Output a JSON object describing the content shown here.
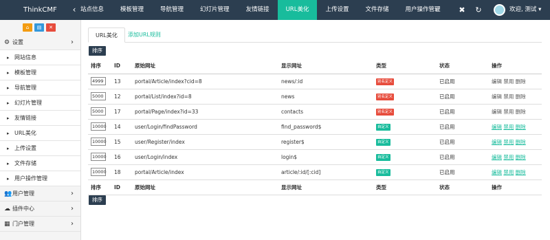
{
  "topbar": {
    "brand": "ThinkCMF",
    "tabs": [
      {
        "label": "站点信息",
        "active": false
      },
      {
        "label": "模板管理",
        "active": false
      },
      {
        "label": "导航管理",
        "active": false
      },
      {
        "label": "幻灯片管理",
        "active": false
      },
      {
        "label": "友情链接",
        "active": false
      },
      {
        "label": "URL美化",
        "active": true
      },
      {
        "label": "上传设置",
        "active": false
      },
      {
        "label": "文件存储",
        "active": false
      },
      {
        "label": "用户操作管理",
        "active": false
      }
    ],
    "icons": [
      "chevron-left-icon",
      "chevron-right-icon",
      "close-icon",
      "refresh-icon",
      "avatar"
    ],
    "user": "欢迎, 测试",
    "user_caret": "▾"
  },
  "sidebar": {
    "quick_buttons": [
      {
        "icon": "home-icon",
        "color": "#f39c12"
      },
      {
        "icon": "file-icon",
        "color": "#3498db"
      },
      {
        "icon": "trash-icon",
        "color": "#e74c3c"
      }
    ],
    "settings": {
      "label": "设置",
      "icon": "gears-icon"
    },
    "sub_items": [
      "网站信息",
      "模板管理",
      "导航管理",
      "幻灯片管理",
      "友情链接",
      "URL美化",
      "上传设置",
      "文件存储",
      "用户操作管理"
    ],
    "groups": [
      {
        "label": "用户管理",
        "icon": "users-icon"
      },
      {
        "label": "插件中心",
        "icon": "cloud-icon"
      },
      {
        "label": "门户管理",
        "icon": "grid-icon"
      }
    ]
  },
  "main": {
    "tabs": [
      "URL美化",
      "添加URL规则"
    ],
    "sort_button": "排序",
    "columns": [
      "排序",
      "ID",
      "原始网址",
      "显示网址",
      "类型",
      "状态",
      "操作"
    ],
    "rows": [
      {
        "order": "4999",
        "id": "13",
        "original": "portal/Article/index?cid=8",
        "display": "news/:id",
        "type": "别名定义",
        "type_color": "#e74c3c",
        "status": "已启用",
        "a1": "编辑",
        "a2": "禁用",
        "a3": "删除",
        "action_color": "#555"
      },
      {
        "order": "5000",
        "id": "12",
        "original": "portal/List/index?id=8",
        "display": "news",
        "type": "别名定义",
        "type_color": "#e74c3c",
        "status": "已启用",
        "a1": "编辑",
        "a2": "禁用",
        "a3": "删除",
        "action_color": "#555"
      },
      {
        "order": "5000",
        "id": "17",
        "original": "portal/Page/index?id=33",
        "display": "contacts",
        "type": "别名定义",
        "type_color": "#e74c3c",
        "status": "已启用",
        "a1": "编辑",
        "a2": "禁用",
        "a3": "删除",
        "action_color": "#555"
      },
      {
        "order": "10000",
        "id": "14",
        "original": "user/Login/findPassword",
        "display": "find_password$",
        "type": "自定义",
        "type_color": "#18bc9c",
        "status": "已启用",
        "a1": "编辑",
        "a2": "禁用",
        "a3": "删除",
        "action_color": "#18bc9c"
      },
      {
        "order": "10000",
        "id": "15",
        "original": "user/Register/index",
        "display": "register$",
        "type": "自定义",
        "type_color": "#18bc9c",
        "status": "已启用",
        "a1": "编辑",
        "a2": "禁用",
        "a3": "删除",
        "action_color": "#18bc9c"
      },
      {
        "order": "10000",
        "id": "16",
        "original": "user/Login/index",
        "display": "login$",
        "type": "自定义",
        "type_color": "#18bc9c",
        "status": "已启用",
        "a1": "编辑",
        "a2": "禁用",
        "a3": "删除",
        "action_color": "#18bc9c"
      },
      {
        "order": "10000",
        "id": "18",
        "original": "portal/Article/index",
        "display": "article/:id/[:cid]",
        "type": "自定义",
        "type_color": "#18bc9c",
        "status": "已启用",
        "a1": "编辑",
        "a2": "禁用",
        "a3": "删除",
        "action_color": "#18bc9c"
      }
    ]
  },
  "colors": {
    "topbar": "#2c3e50",
    "accent": "#18bc9c",
    "danger": "#e74c3c"
  }
}
